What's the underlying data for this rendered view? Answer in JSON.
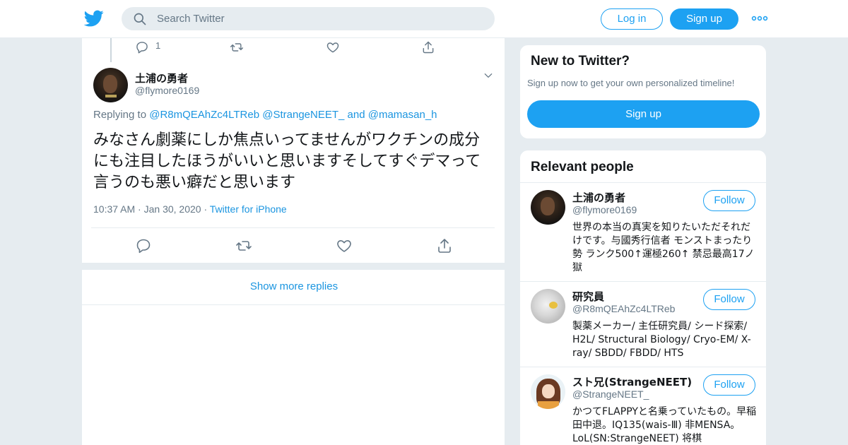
{
  "header": {
    "search_placeholder": "Search Twitter",
    "login_label": "Log in",
    "signup_label": "Sign up",
    "brand_color": "#1da1f2"
  },
  "prev_tweet": {
    "reply_count": "1"
  },
  "tweet": {
    "author_name": "土浦の勇者",
    "author_handle": "@flymore0169",
    "replying_prefix": "Replying to",
    "replying_to_1": "@R8mQEAhZc4LTReb",
    "replying_to_2": "@StrangeNEET_",
    "replying_and": "and",
    "replying_to_3": "@mamasan_h",
    "text": "みなさん劇薬にしか焦点いってませんがワクチンの成分にも注目したほうがいいと思いますそしてすぐデマって言うのも悪い癖だと思います",
    "time": "10:37 AM",
    "date": "Jan 30, 2020",
    "source": "Twitter for iPhone"
  },
  "show_more_label": "Show more replies",
  "new_to_twitter": {
    "title": "New to Twitter?",
    "subtitle": "Sign up now to get your own personalized timeline!",
    "signup_label": "Sign up"
  },
  "relevant_people": {
    "title": "Relevant people",
    "follow_label": "Follow",
    "people": [
      {
        "name": "土浦の勇者",
        "handle": "@flymore0169",
        "bio": "世界の本当の真実を知りたいただそれだけです。与國秀行信者 モンストまったり勢 ランク500↑運極260↑ 禁忌最高17ノ獄"
      },
      {
        "name": "研究員",
        "handle": "@R8mQEAhZc4LTReb",
        "bio": "製薬メーカー/ 主任研究員/ シード探索/ H2L/ Structural Biology/ Cryo-EM/ X-ray/ SBDD/ FBDD/ HTS"
      },
      {
        "name": "スト兄(StrangeNEET)",
        "handle": "@StrangeNEET_",
        "bio": "かつてFLAPPYと名乗っていたもの。早稲田中退。IQ135(wais-Ⅲ) 非MENSA。 LoL(SN:StrangeNEET) 将棋"
      }
    ]
  }
}
